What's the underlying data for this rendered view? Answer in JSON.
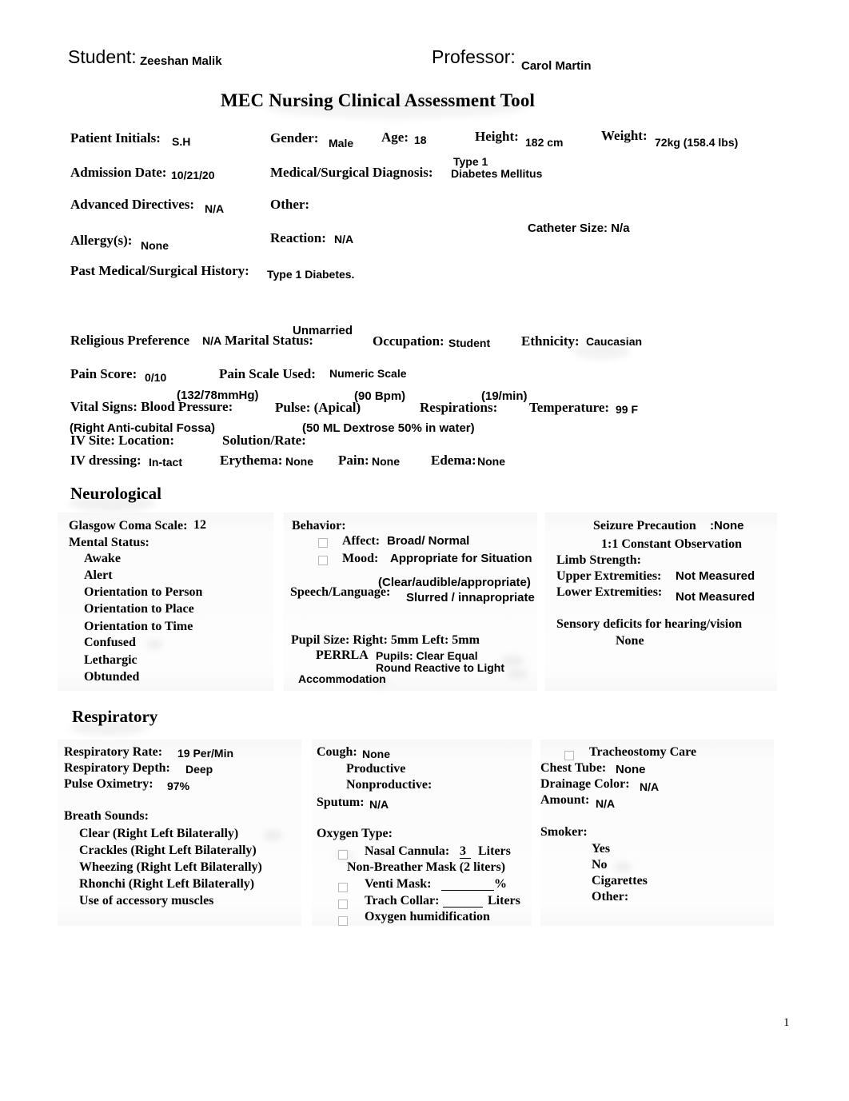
{
  "header": {
    "student_label": "Student:",
    "student_name": "Zeeshan Malik",
    "professor_label": "Professor:",
    "professor_name": "Carol Martin",
    "title": "MEC Nursing Clinical Assessment Tool"
  },
  "patient": {
    "initials_label": "Patient Initials:",
    "initials_value": "S.H",
    "gender_label": "Gender:",
    "gender_value": "Male",
    "age_label": "Age:",
    "age_value": "18",
    "height_label": "Height:",
    "height_value": "182 cm",
    "weight_label": "Weight:",
    "weight_value": "72kg (158.4 lbs)",
    "admission_label": "Admission Date:",
    "admission_value": "10/21/20",
    "diagnosis_label": "Medical/Surgical Diagnosis:",
    "diagnosis_value_line1": "Type 1",
    "diagnosis_value_line2": "Diabetes Mellitus",
    "directives_label": "Advanced Directives:",
    "directives_value": "N/A",
    "other_label": "Other:",
    "catheter_label": "Catheter Size: N/a",
    "allergy_label": "Allergy(s):",
    "allergy_value": "None",
    "reaction_label": "Reaction:",
    "reaction_value": "N/A",
    "history_label": "Past Medical/Surgical History:",
    "history_value": "Type 1 Diabetes."
  },
  "social": {
    "religious_label": "Religious Preference",
    "religious_value": "N/A",
    "marital_label": "Marital Status:",
    "marital_value": "Unmarried",
    "occupation_label": "Occupation:",
    "occupation_value": "Student",
    "ethnicity_label": "Ethnicity:",
    "ethnicity_value": "Caucasian"
  },
  "pain": {
    "score_label": "Pain Score:",
    "score_value": "0/10",
    "scale_label": "Pain Scale Used:",
    "scale_value": "Numeric Scale"
  },
  "vitals": {
    "prefix_label": "Vital Signs: Blood Pressure:",
    "bp_value": "(132/78mmHg)",
    "pulse_label": "Pulse: (Apical)",
    "pulse_value": "(90 Bpm)",
    "respirations_label": "Respirations:",
    "respirations_value": "(19/min)",
    "temperature_label": "Temperature:",
    "temperature_value": "99 F"
  },
  "iv": {
    "site_label": "IV Site: Location:",
    "site_value": "(Right Anti-cubital Fossa)",
    "solution_label": "Solution/Rate:",
    "solution_value": "(50 ML Dextrose 50% in water)",
    "dressing_label": "IV dressing:",
    "dressing_value": "In-tact",
    "erythema_label": "Erythema:",
    "erythema_value": "None",
    "pain_label": "Pain:",
    "pain_value": "None",
    "edema_label": "Edema:",
    "edema_value": "None"
  },
  "neurological": {
    "section_title": "Neurological",
    "gcs_label": "Glasgow Coma Scale:",
    "gcs_value": "12",
    "mental_status_label": "Mental Status:",
    "mental_status_items": [
      "Awake",
      "Alert",
      "Orientation to Person",
      "Orientation to Place",
      "Orientation to Time",
      "Confused",
      "Lethargic",
      "Obtunded"
    ],
    "behavior_label": "Behavior:",
    "affect_label": "Affect:",
    "affect_value": "Broad/ Normal",
    "mood_label": "Mood:",
    "mood_value": "Appropriate for Situation",
    "speech_label": "Speech/Language:",
    "speech_value_line1": "(Clear/audible/appropriate)",
    "speech_value_line2": "Slurred / innapropriate",
    "pupil_size_label": "Pupil Size: Right: 5mm Left: 5mm",
    "perrla_label": "PERRLA",
    "pupils_line1": "Pupils: Clear   Equal",
    "pupils_line2": "Round   Reactive to Light",
    "accommodation_label": "Accommodation",
    "seizure_label": "Seizure Precaution",
    "seizure_value": ":None",
    "observation_label": "1:1 Constant Observation",
    "limb_strength_label": "Limb Strength:",
    "upper_label": "Upper Extremities:",
    "upper_value": "Not Measured",
    "lower_label": "Lower Extremities:",
    "lower_value": "Not Measured",
    "sensory_label": "Sensory deficits for hearing/vision",
    "sensory_value": "None"
  },
  "respiratory": {
    "section_title": "Respiratory",
    "rate_label": "Respiratory Rate:",
    "rate_value": "19 Per/Min",
    "depth_label": "Respiratory Depth:",
    "depth_value": "Deep",
    "oximetry_label": "Pulse Oximetry:",
    "oximetry_value": "97%",
    "breath_sounds_label": "Breath Sounds:",
    "breath_sounds_items": [
      "Clear (Right  Left  Bilaterally)",
      "Crackles (Right Left Bilaterally)",
      "Wheezing (Right  Left Bilaterally)",
      "Rhonchi (Right  Left  Bilaterally)",
      "Use of accessory muscles"
    ],
    "cough_label": "Cough:",
    "cough_value": "None",
    "cough_items": [
      "Productive",
      "Nonproductive:"
    ],
    "sputum_label": "Sputum:",
    "sputum_value": "N/A",
    "oxygen_type_label": "Oxygen Type:",
    "nasal_cannula_label": "Nasal Cannula:",
    "nasal_cannula_value": "3",
    "nasal_cannula_unit": "Liters",
    "non_breather_label": "Non-Breather Mask (2 liters)",
    "venti_mask_label": "Venti Mask:",
    "venti_mask_unit": "%",
    "trach_collar_label": "Trach Collar:",
    "trach_collar_unit": "Liters",
    "oxygen_humidification_label": "Oxygen humidification",
    "tracheostomy_label": "Tracheostomy Care",
    "chest_tube_label": "Chest Tube:",
    "chest_tube_value": "None",
    "drainage_label": "Drainage Color:",
    "drainage_value": "N/A",
    "amount_label": "Amount:",
    "amount_value": "N/A",
    "smoker_label": "Smoker:",
    "smoker_items": [
      "Yes",
      "No",
      "Cigarettes",
      "Other:"
    ]
  },
  "footer": {
    "page_number": "1"
  }
}
